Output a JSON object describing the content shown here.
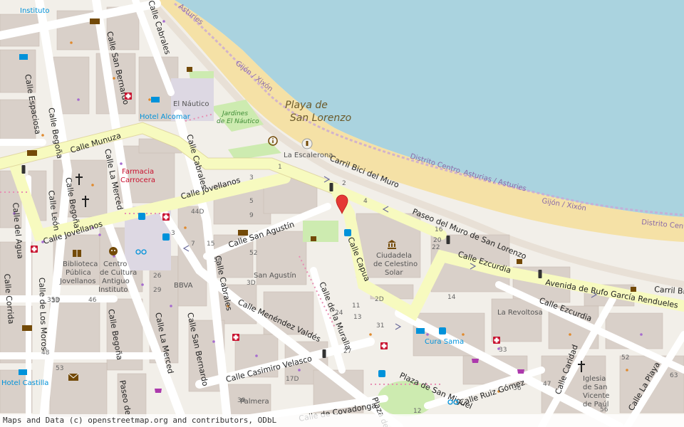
{
  "colors": {
    "sea": "#aad3df",
    "beach": "#f5e1a6",
    "land": "#f2efe9",
    "building": "#d9d0c9",
    "road": "#ffffff",
    "primary_road": "#f7fabf",
    "park": "#cdebb0",
    "marker": "#e53935",
    "boundary": "#a78bc4"
  },
  "marker": {
    "icon": "map-pin-icon"
  },
  "labels": {
    "beach_line1": "Playa de",
    "beach_line2": "San Lorenzo",
    "gijon_top": "Gijón / Xixón",
    "asturias_top": "Asturies",
    "distrito_centro": "Distrito Centro",
    "asturias_asturies": "Asturias / Asturies",
    "gijon_right": "Gijón / Xixón",
    "distrito_centro_right": "Distrito Centro",
    "carril_bici": "Carril Bici del Muro",
    "carril_bici_right": "Carril Bici",
    "paseo_muro": "Paseo del Muro de San Lorenzo",
    "la_escalerona": "La Escalerona",
    "el_nautico": "El Náutico",
    "jardines_1": "Jardines",
    "jardines_2": "de El Náutico",
    "hotel_alcomar": "Hotel Alcomar",
    "hotel_castilla": "Hotel Castilla",
    "instituto": "Instituto",
    "farmacia_1": "Farmacia",
    "farmacia_2": "Carrocera",
    "calle_munuza": "Calle Munuza",
    "calle_jovellanos": "Calle Jovellanos",
    "calle_jovellanos_2": "Calle Jovellanos",
    "calle_cabrales_top": "Calle Cabrales",
    "calle_cabrales": "Calle Cabrales",
    "calle_cabrales_2": "Calle Cabrales",
    "calle_san_bernardo": "Calle San Bernardo",
    "calle_san_bernardo_2": "Calle San Bernardo",
    "calle_espaciosa": "Calle Espaciosa",
    "calle_begona": "Calle Begoña",
    "calle_begona_2": "Calle Begoña",
    "calle_begona_3": "Calle Begoña",
    "calle_la_merced": "Calle La Merced",
    "calle_la_merced_2": "Calle La Merced",
    "calle_leon": "Calle León",
    "calle_del_agua": "Calle del Agua",
    "calle_corrida": "Calle Corrida",
    "calle_de_los_moros": "Calle de Los Moros",
    "calle_san_agustin": "Calle San Agustín",
    "calle_capua": "Calle Capua",
    "calle_ezcurdia": "Calle Ezcurdia",
    "calle_ezcurdia_2": "Calle Ezcurdia",
    "avenida_rufo": "Avenida de Rufo García Rendueles",
    "calle_menendez": "Calle Menéndez Valdés",
    "calle_muralla": "Calle de la Muralla",
    "calle_casimiro": "Calle Casimiro Velasco",
    "plaza_san_miguel": "Plaza de San Miguel",
    "calle_ruiz_gomez": "Calle Ruiz Gómez",
    "calle_caridad": "Calle Caridad",
    "calle_la_playa": "Calle La Playa",
    "calle_covadonga": "Calle de Covadonga",
    "paseo_de": "Paseo de",
    "plaza_short": "Plaza de",
    "ciudadela_1": "Ciudadela",
    "ciudadela_2": "de Celestino",
    "ciudadela_3": "Solar",
    "san_agustin": "San Agustín",
    "biblioteca_1": "Biblioteca",
    "biblioteca_2": "Pública",
    "biblioteca_3": "Jovellanos",
    "centro_1": "Centro",
    "centro_2": "de Cultura",
    "centro_3": "Antiguo",
    "centro_4": "Instituto",
    "bbva": "BBVA",
    "la_revoltosa": "La Revoltosa",
    "cura_sama": "Cura Sama",
    "palmera": "Palmera",
    "iglesia_1": "Iglesia",
    "iglesia_2": "de San",
    "iglesia_3": "Vicente",
    "iglesia_4": "de Paúl"
  },
  "house_numbers": [
    "4",
    "2",
    "1",
    "3",
    "5",
    "9",
    "44D",
    "3",
    "7",
    "15",
    "56",
    "52",
    "3D",
    "26",
    "29",
    "33",
    "35D",
    "46",
    "48",
    "53",
    "16",
    "20",
    "22",
    "11",
    "13",
    "2D",
    "24",
    "27",
    "31",
    "12",
    "33",
    "36",
    "47",
    "52",
    "56",
    "63",
    "14",
    "17D",
    "39"
  ],
  "attribution": "Maps and Data (c) openstreetmap.org and contributors, ODbL"
}
